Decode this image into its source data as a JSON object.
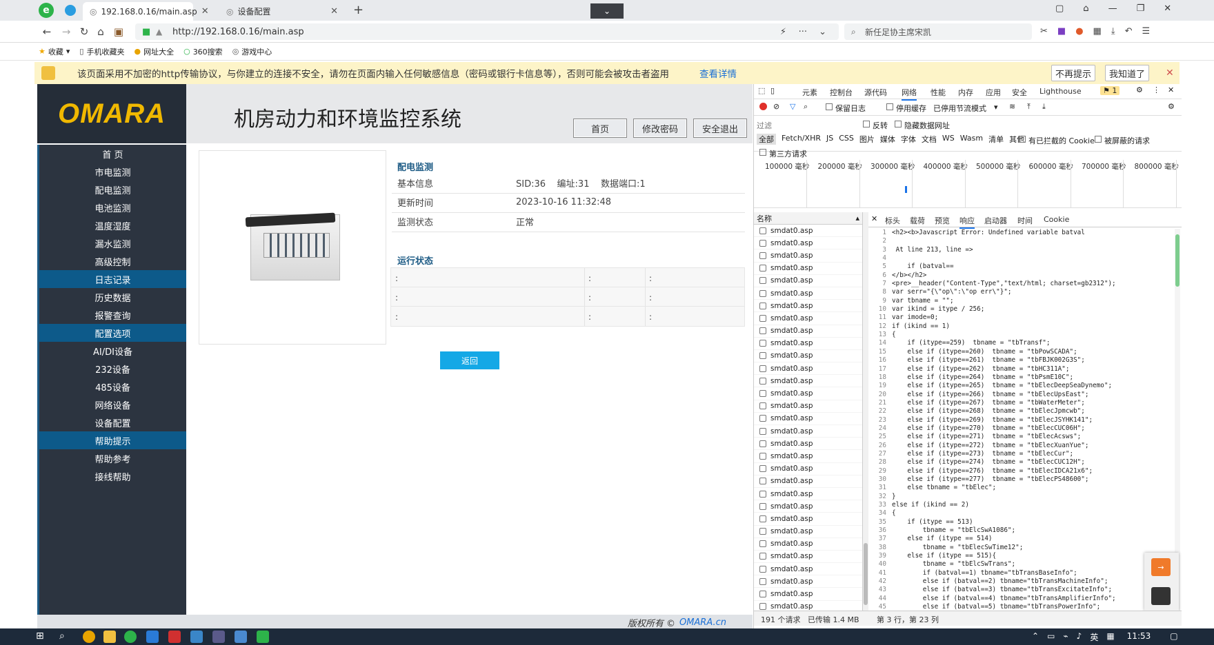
{
  "browser": {
    "tabs": [
      {
        "title": "192.168.0.16/main.asp"
      },
      {
        "title": "设备配置"
      }
    ],
    "url": "http://192.168.0.16/main.asp",
    "search_text": "新任足协主席宋凯",
    "bookmarks": [
      "收藏",
      "手机收藏夹",
      "网址大全",
      "360搜索",
      "游戏中心"
    ]
  },
  "warning": {
    "text": "该页面采用不加密的http传输协议，与你建立的连接不安全，请勿在页面内输入任何敏感信息（密码或银行卡信息等），否则可能会被攻击者盗用",
    "link": "查看详情",
    "btn_no_remind": "不再提示",
    "btn_ok": "我知道了"
  },
  "app": {
    "logo": "OMARA",
    "title": "机房动力和环境监控系统",
    "buttons": {
      "home": "首页",
      "change_pwd": "修改密码",
      "logout": "安全退出"
    },
    "sidebar": [
      {
        "label": "首 页",
        "group": false
      },
      {
        "label": "市电监测",
        "group": false
      },
      {
        "label": "配电监测",
        "group": false
      },
      {
        "label": "电池监测",
        "group": false
      },
      {
        "label": "温度湿度",
        "group": false
      },
      {
        "label": "漏水监测",
        "group": false
      },
      {
        "label": "高级控制",
        "group": false
      },
      {
        "label": "日志记录",
        "group": true
      },
      {
        "label": "历史数据",
        "group": false
      },
      {
        "label": "报警查询",
        "group": false
      },
      {
        "label": "配置选项",
        "group": true
      },
      {
        "label": "AI/DI设备",
        "group": false
      },
      {
        "label": "232设备",
        "group": false
      },
      {
        "label": "485设备",
        "group": false
      },
      {
        "label": "网络设备",
        "group": false
      },
      {
        "label": "设备配置",
        "group": false
      },
      {
        "label": "帮助提示",
        "group": true
      },
      {
        "label": "帮助参考",
        "group": false
      },
      {
        "label": "接线帮助",
        "group": false
      }
    ],
    "section_title": "配电监测",
    "info": {
      "basic_label": "基本信息",
      "basic_value": "SID:36    编址:31    数据端口:1",
      "update_label": "更新时间",
      "update_value": "2023-10-16 11:32:48",
      "status_label": "监测状态",
      "status_value": "正常"
    },
    "run_title": "运行状态",
    "run_rows": [
      [
        ":",
        ":",
        ":"
      ],
      [
        ":",
        ":",
        ":"
      ],
      [
        ":",
        ":",
        ":"
      ]
    ],
    "back_button": "返回",
    "footer_text": "版权所有 ©",
    "footer_brand": "OMARA.cn"
  },
  "devtools": {
    "tabs": [
      "元素",
      "控制台",
      "源代码",
      "网络",
      "性能",
      "内存",
      "应用",
      "安全",
      "Lighthouse"
    ],
    "issues_badge": "1",
    "preserve_log": "保留日志",
    "disable_cache": "停用缓存",
    "throttle": "已停用节流模式",
    "filter_placeholder": "过滤",
    "invert": "反转",
    "hide_data_urls": "隐藏数据网址",
    "types": [
      "全部",
      "Fetch/XHR",
      "JS",
      "CSS",
      "图片",
      "媒体",
      "字体",
      "文档",
      "WS",
      "Wasm",
      "清单",
      "其他"
    ],
    "blocked_cookies": "有已拦截的 Cookie",
    "blocked_requests": "被屏蔽的请求",
    "third_party": "第三方请求",
    "timeline_ticks": [
      "100000 毫秒",
      "200000 毫秒",
      "300000 毫秒",
      "400000 毫秒",
      "500000 毫秒",
      "600000 毫秒",
      "700000 毫秒",
      "800000 毫秒"
    ],
    "name_header": "名称",
    "request_name": "smdat0.asp",
    "request_count": 31,
    "response_tabs": [
      "标头",
      "载荷",
      "预览",
      "响应",
      "启动器",
      "时间",
      "Cookie"
    ],
    "code_lines": [
      "<h2><b>Javascript Error: Undefined variable batval",
      "",
      " At line 213, line =>",
      "",
      "    if (batval==",
      "</b></h2>",
      "<pre>__header(\"Content-Type\",\"text/html; charset=gb2312\");",
      "var serr=\"{\\\"op\\\":\\\"op err\\\"}\";",
      "var tbname = \"\";",
      "var ikind = itype / 256;",
      "var imode=0;",
      "if (ikind == 1)",
      "{",
      "    if (itype==259)  tbname = \"tbTransf\";",
      "    else if (itype==260)  tbname = \"tbPowSCADA\";",
      "    else if (itype==261)  tbname = \"tbFBJK002G3S\";",
      "    else if (itype==262)  tbname = \"tbHC311A\";",
      "    else if (itype==264)  tbname = \"tbPsmE10C\";",
      "    else if (itype==265)  tbname = \"tbElecDeepSeaDynemo\";",
      "    else if (itype==266)  tbname = \"tbElecUpsEast\";",
      "    else if (itype==267)  tbname = \"tbWaterMeter\";",
      "    else if (itype==268)  tbname = \"tbElecJpmcwb\";",
      "    else if (itype==269)  tbname = \"tbElecJSYHK141\";",
      "    else if (itype==270)  tbname = \"tbElecCUC06H\";",
      "    else if (itype==271)  tbname = \"tbElecAcsws\";",
      "    else if (itype==272)  tbname = \"tbElecXuanYue\";",
      "    else if (itype==273)  tbname = \"tbElecCur\";",
      "    else if (itype==274)  tbname = \"tbElecCUC12H\";",
      "    else if (itype==276)  tbname = \"tbElecIDCA21x6\";",
      "    else if (itype==277)  tbname = \"tbElecPS48600\";",
      "    else tbname = \"tbElec\";",
      "}",
      "else if (ikind == 2)",
      "{",
      "    if (itype == 513)",
      "        tbname = \"tbElcSwA1086\";",
      "    else if (itype == 514)",
      "        tbname = \"tbElecSwTime12\";",
      "    else if (itype == 515){",
      "        tbname = \"tbElcSwTrans\";",
      "        if (batval==1) tbname=\"tbTransBaseInfo\";",
      "        else if (batval==2) tbname=\"tbTransMachineInfo\";",
      "        else if (batval==3) tbname=\"tbTransExcitateInfo\";",
      "        else if (batval==4) tbname=\"tbTransAmplifierInfo\";",
      "        else if (batval==5) tbname=\"tbTransPowerInfo\";"
    ],
    "status_requests": "191 个请求",
    "status_transferred": "已传输 1.4 MB",
    "status_line": "第 3 行，第 23 列"
  },
  "taskbar": {
    "lang": "英",
    "time": "11:53"
  },
  "colors": {
    "nav_group": "#0d5a8a",
    "sidebar_bg": "#2c3440",
    "logo_bg": "#252d38",
    "logo_text": "#f0b800",
    "back_button": "#14a8e6",
    "warning_bg": "#fdf4c8"
  }
}
